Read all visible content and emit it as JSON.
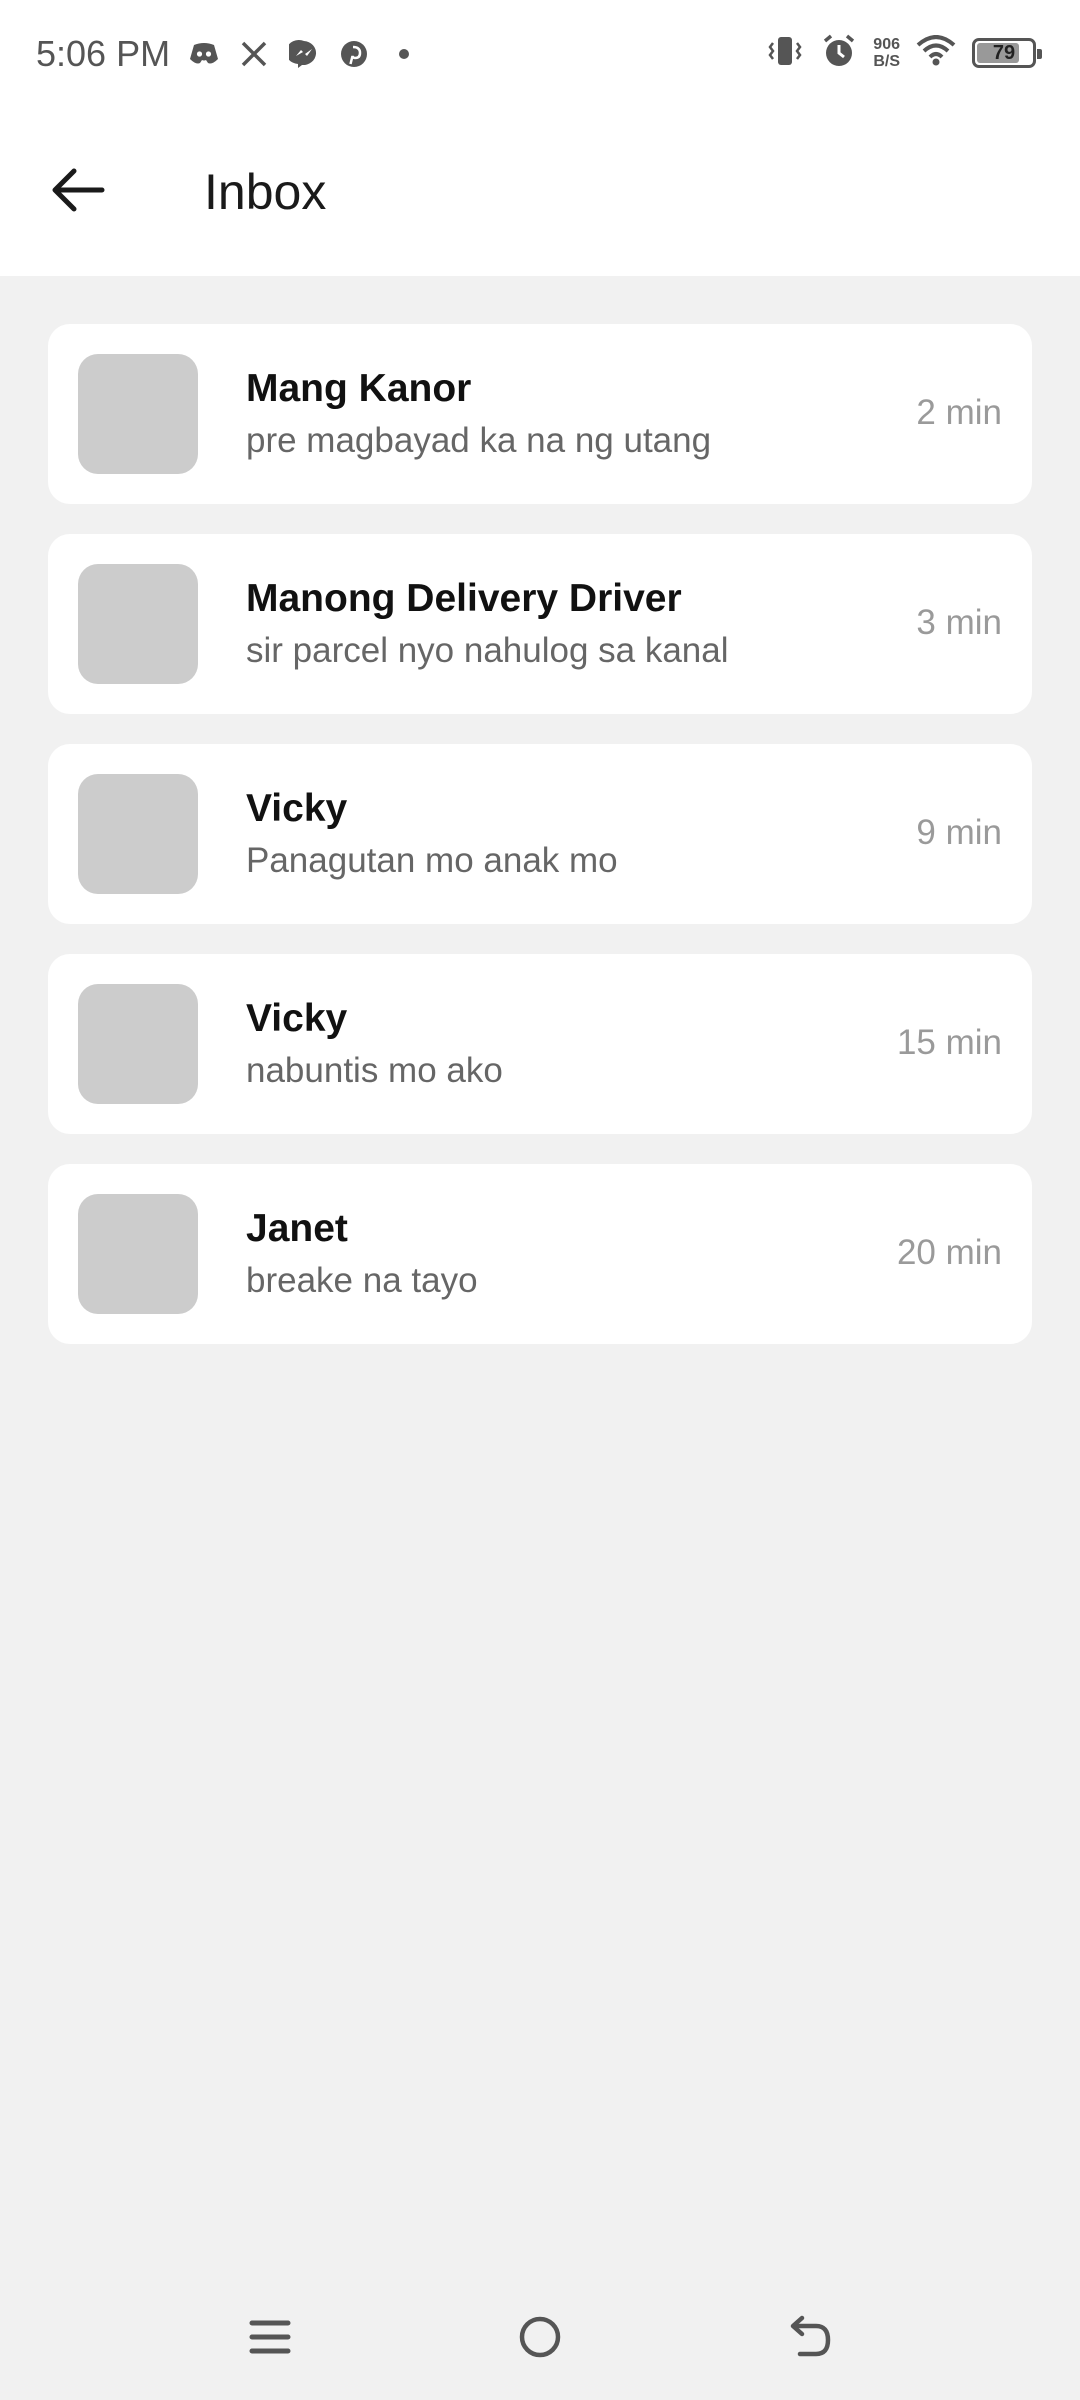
{
  "status_bar": {
    "time": "5:06 PM",
    "left_icons": [
      "discord-icon",
      "x-icon",
      "messenger-icon",
      "pinterest-icon",
      "dot-icon"
    ],
    "network_speed_value": "906",
    "network_speed_unit": "B/S",
    "battery_level": "79",
    "battery_percent": 79
  },
  "header": {
    "title": "Inbox",
    "back_icon": "arrow-left-icon"
  },
  "messages": [
    {
      "name": "Mang Kanor",
      "preview": "pre magbayad ka na ng utang",
      "time": "2 min"
    },
    {
      "name": "Manong Delivery Driver",
      "preview": "sir parcel nyo nahulog sa kanal",
      "time": "3 min"
    },
    {
      "name": "Vicky",
      "preview": "Panagutan mo anak mo",
      "time": "9 min"
    },
    {
      "name": "Vicky",
      "preview": "nabuntis mo ako",
      "time": "15 min"
    },
    {
      "name": "Janet",
      "preview": "breake na tayo",
      "time": "20 min"
    }
  ],
  "nav_bar": {
    "icons": [
      "menu-icon",
      "home-icon",
      "back-icon"
    ]
  },
  "colors": {
    "background": "#f1f1f1",
    "card": "#ffffff",
    "avatar_placeholder": "#cccccc"
  }
}
